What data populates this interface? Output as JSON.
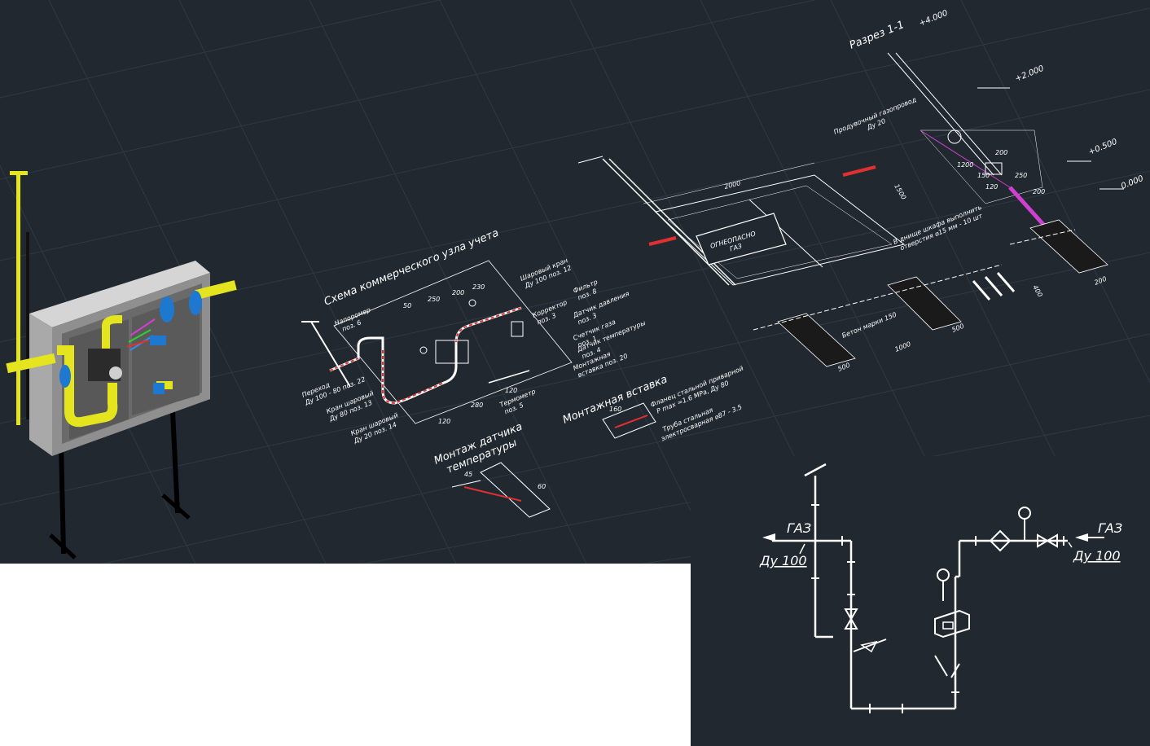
{
  "section": {
    "title": "Разрез 1-1",
    "elev_4000": "+4.000",
    "elev_2000": "+2.000",
    "elev_0500": "+0.500",
    "elev_0000": "0.000",
    "pipeline_line1": "Продувочный газопровод",
    "pipeline_line2": "Ду 20",
    "dim_2000": "2000",
    "dim_1500": "1500",
    "dim_1000": "1000",
    "dim_500": "500",
    "dim_500b": "500",
    "dim_200": "200",
    "dim_150": "150",
    "dim_250": "250",
    "dim_1200": "1200",
    "dim_120": "120",
    "dim_200b": "200",
    "dim_200c": "200",
    "dim_400": "400",
    "sign_line1": "ОГНЕОПАСНО",
    "sign_line2": "ГАЗ",
    "note_line1": "В днище шкафа выполнить",
    "note_line2": "отверстия ⌀15 мм - 10 шт",
    "concrete": "Бетон марки 150"
  },
  "scheme": {
    "title": "Схема коммерческого узла учета",
    "dims_top": [
      "50",
      "250",
      "200",
      "230"
    ],
    "dims_bottom": [
      "120",
      "280",
      "120"
    ],
    "callouts": [
      {
        "line1": "Шаровый кран",
        "line2": "Ду 100  поз. 12"
      },
      {
        "line1": "Фильтр",
        "line2": "поз. 8"
      },
      {
        "line1": "Корректор",
        "line2": "поз. 3"
      },
      {
        "line1": "Датчик давления",
        "line2": "поз. 3"
      },
      {
        "line1": "Счетчик газа",
        "line2": "поз. 1"
      },
      {
        "line1": "Датчик температуры",
        "line2": "поз. 4"
      },
      {
        "line1": "Монтажная",
        "line2": "вставка поз. 20"
      },
      {
        "line1": "Термометр",
        "line2": "поз. 5"
      },
      {
        "line1": "Напоромер",
        "line2": "поз. 6"
      },
      {
        "line1": "Переход",
        "line2": "Ду 100 - 80  поз. 22"
      },
      {
        "line1": "Кран шаровый",
        "line2": "Ду 80  поз. 13"
      },
      {
        "line1": "Кран шаровый",
        "line2": "Ду 20  поз. 14"
      }
    ]
  },
  "insert": {
    "title": "Монтажная вставка",
    "dim": "160",
    "flange_line1": "Фланец стальной приварной",
    "flange_line2": "P max =1.6 MPa, Ду 80",
    "pipe_line1": "Труба стальная",
    "pipe_line2": "электросварная  ⌀87 - 3.5"
  },
  "sensor": {
    "title_line1": "Монтаж датчика",
    "title_line2": "температуры",
    "dim_a": "45",
    "dim_b": "60"
  },
  "schematic": {
    "out_label": "ГАЗ",
    "out_dn": "Ду 100",
    "in_label": "ГАЗ",
    "in_dn": "Ду 100"
  },
  "colors": {
    "background": "#212830",
    "grid": "#2f3945",
    "line": "#ffffff",
    "pipe_yellow": "#e4e41f",
    "accent_red": "#e03030",
    "accent_magenta": "#d040d0",
    "meter_blue": "#1f78d0"
  }
}
